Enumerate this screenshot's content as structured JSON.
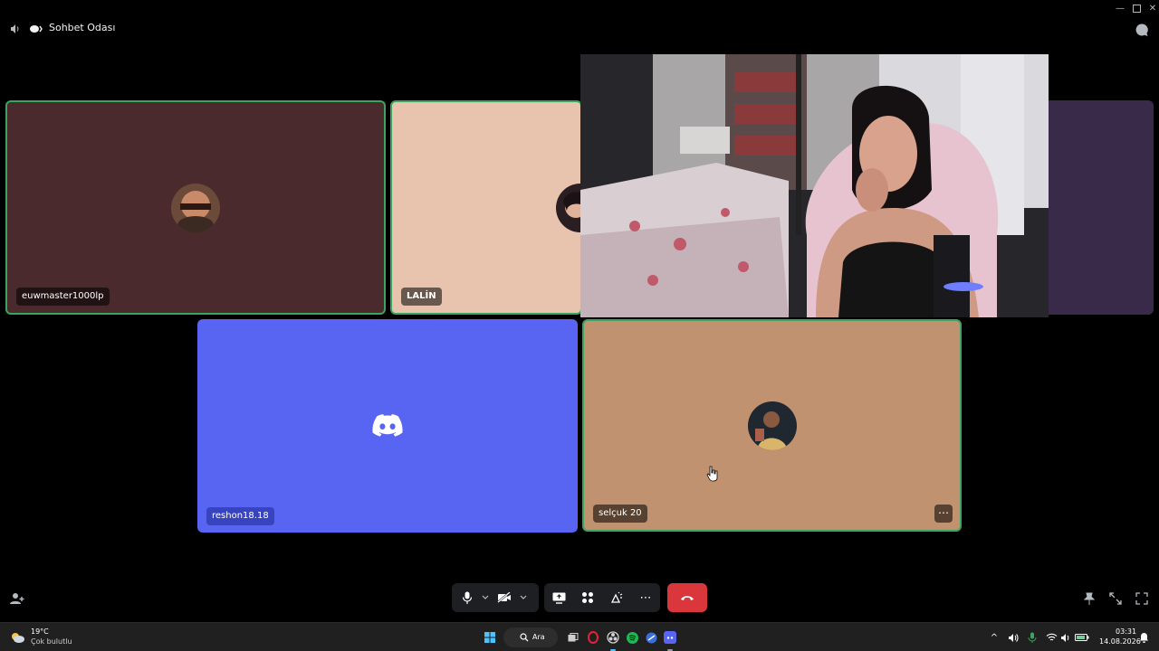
{
  "window": {
    "title": "Sohbet Odası"
  },
  "participants": [
    {
      "name": "euwmaster1000lp"
    },
    {
      "name": "LALİN"
    },
    {
      "name": "reshon18.18"
    },
    {
      "name": "selçuk 20"
    }
  ],
  "tile_colors": {
    "euwmaster": "#4a2a2c",
    "lalin": "#e8c4ae",
    "reshon": "#5865f2",
    "selcuk": "#c19270",
    "far_right": "#3a2a4a"
  },
  "taskbar": {
    "weather_temp": "19°C",
    "weather_desc": "Çok bulutlu",
    "search_label": "Ara",
    "time": "03:31",
    "date": "14.08.2026"
  }
}
